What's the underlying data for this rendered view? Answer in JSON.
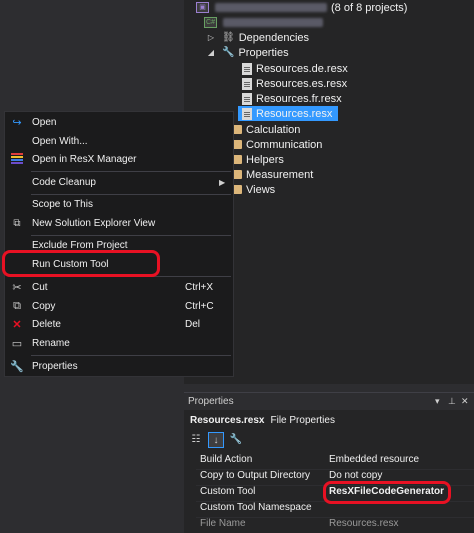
{
  "tree": {
    "solution_suffix": "(8 of 8 projects)",
    "project_icon_text": "C#",
    "nodes": {
      "dependencies": "Dependencies",
      "properties": "Properties",
      "res_de": "Resources.de.resx",
      "res_es": "Resources.es.resx",
      "res_fr": "Resources.fr.resx",
      "res_main": "Resources.resx",
      "calculation": "Calculation",
      "communication": "Communication",
      "helpers": "Helpers",
      "measurement": "Measurement",
      "views": "Views"
    }
  },
  "menu": {
    "open": "Open",
    "open_with": "Open With...",
    "open_resx": "Open in ResX Manager",
    "code_cleanup": "Code Cleanup",
    "scope": "Scope to This",
    "new_view": "New Solution Explorer View",
    "exclude": "Exclude From Project",
    "run_tool": "Run Custom Tool",
    "cut": "Cut",
    "cut_sc": "Ctrl+X",
    "copy": "Copy",
    "copy_sc": "Ctrl+C",
    "delete": "Delete",
    "delete_sc": "Del",
    "rename": "Rename",
    "properties": "Properties"
  },
  "props": {
    "title": "Properties",
    "object_name": "Resources.resx",
    "object_type": "File Properties",
    "rows": [
      {
        "key": "Build Action",
        "value": "Embedded resource"
      },
      {
        "key": "Copy to Output Directory",
        "value": "Do not copy"
      },
      {
        "key": "Custom Tool",
        "value": "ResXFileCodeGenerator"
      },
      {
        "key": "Custom Tool Namespace",
        "value": ""
      },
      {
        "key": "File Name",
        "value": "Resources.resx"
      }
    ]
  },
  "colors": {
    "highlight_box": "#e81123",
    "selection": "#3399ff",
    "folder": "#dcb67a"
  }
}
